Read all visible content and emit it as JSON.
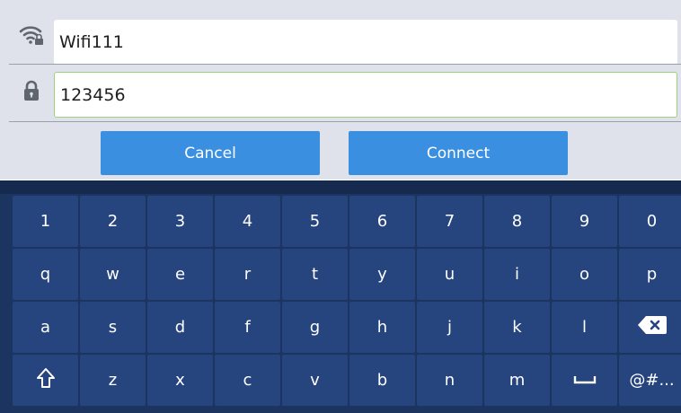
{
  "form": {
    "ssid_value": "Wifi111",
    "password_value": "123456",
    "cancel_label": "Cancel",
    "connect_label": "Connect"
  },
  "keyboard": {
    "rows": [
      [
        "1",
        "2",
        "3",
        "4",
        "5",
        "6",
        "7",
        "8",
        "9",
        "0"
      ],
      [
        "q",
        "w",
        "e",
        "r",
        "t",
        "y",
        "u",
        "i",
        "o",
        "p"
      ],
      [
        "a",
        "s",
        "d",
        "f",
        "g",
        "h",
        "j",
        "k",
        "l",
        "backspace-icon"
      ],
      [
        "shift-icon",
        "z",
        "x",
        "c",
        "v",
        "b",
        "n",
        "m",
        "space-icon",
        "@#..."
      ]
    ]
  },
  "colors": {
    "keyboard_bg": "#1b3460",
    "key_bg": "#26447d",
    "button_bg": "#3b8fe0",
    "field_focus_border": "#9dd27b"
  }
}
